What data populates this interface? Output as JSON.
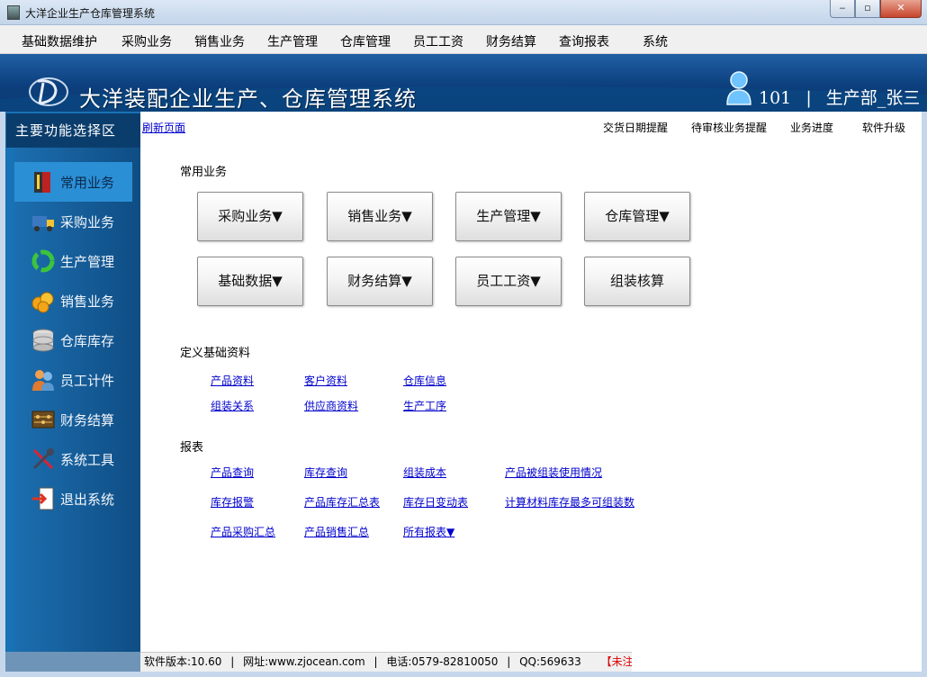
{
  "window": {
    "title": "大洋企业生产仓库管理系统",
    "minimize": "‒",
    "maximize": "▫",
    "close": "✕"
  },
  "menubar": [
    "基础数据维护",
    "采购业务",
    "销售业务",
    "生产管理",
    "仓库管理",
    "员工工资",
    "财务结算",
    "查询报表",
    "系统"
  ],
  "header": {
    "app_title": "大洋装配企业生产、仓库管理系统",
    "user_id": "101",
    "separator": "|",
    "user_dept": "生产部_张三"
  },
  "sidebar": {
    "title": "主要功能选择区",
    "items": [
      {
        "label": "常用业务",
        "icon": "book-icon"
      },
      {
        "label": "采购业务",
        "icon": "truck-icon"
      },
      {
        "label": "生产管理",
        "icon": "recycle-icon"
      },
      {
        "label": "销售业务",
        "icon": "coins-icon"
      },
      {
        "label": "仓库库存",
        "icon": "database-icon"
      },
      {
        "label": "员工计件",
        "icon": "users-icon"
      },
      {
        "label": "财务结算",
        "icon": "abacus-icon"
      },
      {
        "label": "系统工具",
        "icon": "tools-icon"
      },
      {
        "label": "退出系统",
        "icon": "exit-icon"
      }
    ]
  },
  "content": {
    "refresh": "刷新页面",
    "top_links": [
      "交货日期提醒",
      "待审核业务提醒",
      "业务进度",
      "软件升级"
    ],
    "common_title": "常用业务",
    "common_buttons": [
      "采购业务▼",
      "销售业务▼",
      "生产管理▼",
      "仓库管理▼",
      "基础数据▼",
      "财务结算▼",
      "员工工资▼",
      "组装核算"
    ],
    "basic_title": "定义基础资料",
    "basic_links": [
      "产品资料",
      "客户资料",
      "仓库信息",
      "组装关系",
      "供应商资料",
      "生产工序"
    ],
    "report_title": "报表",
    "report_links": [
      "产品查询",
      "库存查询",
      "组装成本",
      "产品被组装使用情况",
      "库存报警",
      "产品库存汇总表",
      "库存日变动表",
      "计算材料库存最多可组装数",
      "产品采购汇总",
      "产品销售汇总",
      "所有报表▼"
    ]
  },
  "status": {
    "version": "软件版本:10.60",
    "website": "网址:www.zjocean.com",
    "phone": "电话:0579-82810050",
    "qq": "QQ:569633",
    "reg": "【未注册】",
    "sep": "|"
  },
  "colors": {
    "header_blue": "#0c3f7d",
    "sidebar_blue": "#1872b6",
    "link_blue": "#0000cc",
    "unregistered_red": "#dd0000"
  }
}
